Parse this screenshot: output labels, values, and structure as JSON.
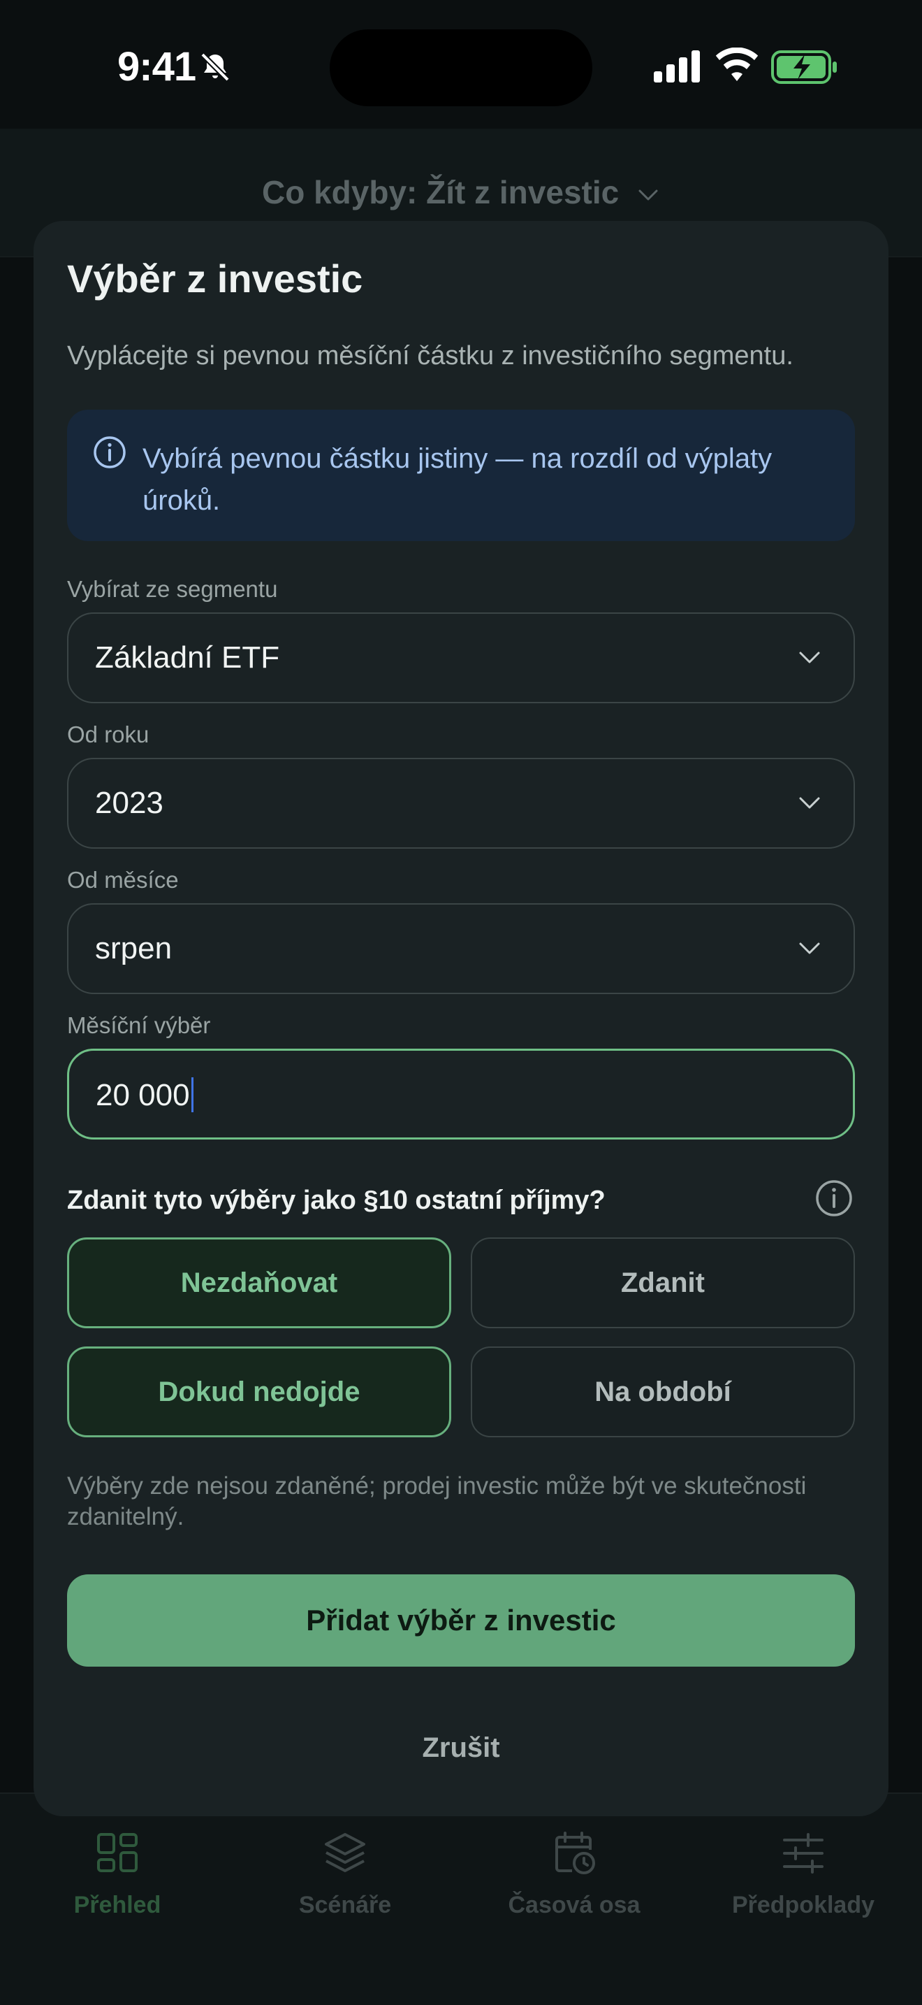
{
  "status_bar": {
    "time": "9:41"
  },
  "page": {
    "title": "Co kdyby: Žít z investic"
  },
  "sheet": {
    "title": "Výběr z investic",
    "subtitle": "Vyplácejte si pevnou měsíční částku z investičního segmentu.",
    "info_text": "Vybírá pevnou částku jistiny — na rozdíl od výplaty úroků.",
    "fields": {
      "segment": {
        "label": "Vybírat ze segmentu",
        "value": "Základní ETF"
      },
      "year": {
        "label": "Od roku",
        "value": "2023"
      },
      "month": {
        "label": "Od měsíce",
        "value": "srpen"
      },
      "amount": {
        "label": "Měsíční výběr",
        "value": "20 000"
      }
    },
    "tax_question": "Zdanit tyto výběry jako §10 ostatní příjmy?",
    "tax_options": [
      {
        "label": "Nezdaňovat",
        "selected": true
      },
      {
        "label": "Zdanit",
        "selected": false
      }
    ],
    "duration_options": [
      {
        "label": "Dokud nedojde",
        "selected": true
      },
      {
        "label": "Na období",
        "selected": false
      }
    ],
    "note": "Výběry zde nejsou zdaněné; prodej investic může být ve skutečnosti zdanitelný.",
    "primary_button": "Přidat výběr z investic",
    "cancel_button": "Zrušit"
  },
  "tabbar": {
    "tabs": [
      {
        "label": "Přehled",
        "icon": "grid-icon",
        "active": true
      },
      {
        "label": "Scénáře",
        "icon": "layers-icon",
        "active": false
      },
      {
        "label": "Časová osa",
        "icon": "calendar-clock-icon",
        "active": false
      },
      {
        "label": "Předpoklady",
        "icon": "sliders-icon",
        "active": false
      }
    ]
  },
  "colors": {
    "accent": "#62a67b",
    "selected_border": "#67b07e",
    "info_bg": "#17273a",
    "info_text": "#a8c6ef",
    "sheet_bg": "#1a2224"
  }
}
